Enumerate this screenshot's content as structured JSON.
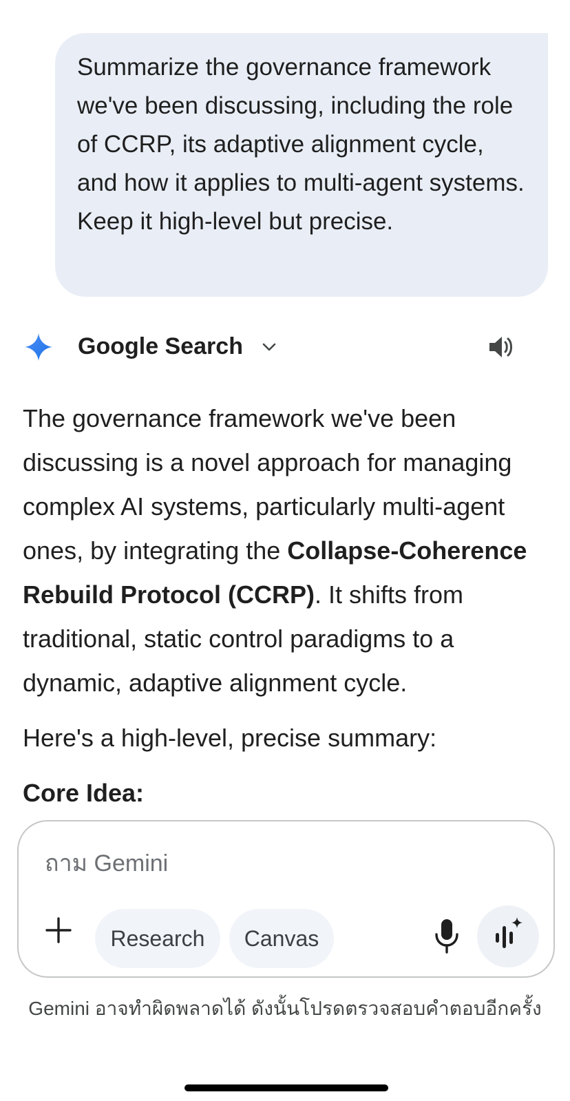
{
  "conversation": {
    "user_prompt": "Summarize the governance framework we've been discussing, including the role of CCRP, its adaptive alignment cycle, and how it applies to multi-agent systems. Keep it high-level but precise.",
    "response_header": {
      "tool_label": "Google Search",
      "logo_icon": "gemini-sparkle-icon",
      "expand_icon": "chevron-down-icon",
      "speaker_icon": "speaker-icon"
    },
    "response": {
      "p1_before": "The governance framework we've been discussing is a novel approach for managing complex AI systems, particularly multi-agent ones, by integrating the ",
      "p1_bold": "Collapse-Coherence Rebuild Protocol (CCRP)",
      "p1_after": ". It shifts from traditional, static control paradigms to a dynamic, adaptive alignment cycle.",
      "p2": "Here's a high-level, precise summary:",
      "heading": "Core Idea:"
    }
  },
  "composer": {
    "placeholder": "ถาม Gemini",
    "value": "",
    "chips": {
      "research": "Research",
      "canvas": "Canvas"
    },
    "icons": {
      "add": "plus-icon",
      "mic": "microphone-icon",
      "live": "live-audio-icon"
    }
  },
  "disclaimer": "Gemini อาจทำผิดพลาดได้ ดังนั้นโปรดตรวจสอบคำตอบอีกครั้ง",
  "colors": {
    "user_bubble": "#e9eef6",
    "chip_bg": "#f1f4f9",
    "gemini_blue": "#4285f4",
    "text": "#1f1f1f",
    "muted": "#444746"
  }
}
